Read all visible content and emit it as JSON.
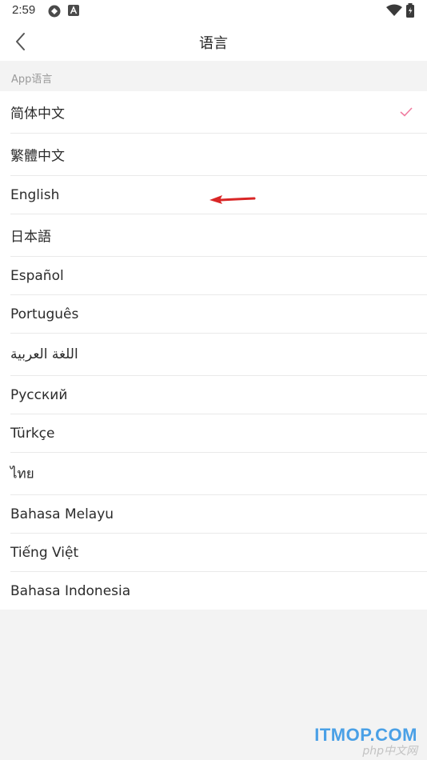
{
  "status_bar": {
    "time": "2:59",
    "icons": [
      "sync-icon",
      "app-a-icon",
      "wifi-icon",
      "battery-icon"
    ]
  },
  "app_bar": {
    "title": "语言",
    "back_icon": "chevron-left-icon"
  },
  "section": {
    "label": "App语言"
  },
  "languages": [
    {
      "label": "简体中文",
      "selected": true
    },
    {
      "label": "繁體中文",
      "selected": false
    },
    {
      "label": "English",
      "selected": false
    },
    {
      "label": "日本語",
      "selected": false
    },
    {
      "label": "Español",
      "selected": false
    },
    {
      "label": "Português",
      "selected": false
    },
    {
      "label": "اللغة العربية",
      "selected": false
    },
    {
      "label": "Русский",
      "selected": false
    },
    {
      "label": "Türkçe",
      "selected": false
    },
    {
      "label": "ไทย",
      "selected": false
    },
    {
      "label": "Bahasa Melayu",
      "selected": false
    },
    {
      "label": "Tiếng Việt",
      "selected": false
    },
    {
      "label": "Bahasa Indonesia",
      "selected": false
    }
  ],
  "colors": {
    "accent_check": "#f07ca0",
    "arrow": "#d92626",
    "watermark": "#4aa0e6"
  },
  "watermark": {
    "main": "ITMOP.COM",
    "sub": "php中文网"
  }
}
